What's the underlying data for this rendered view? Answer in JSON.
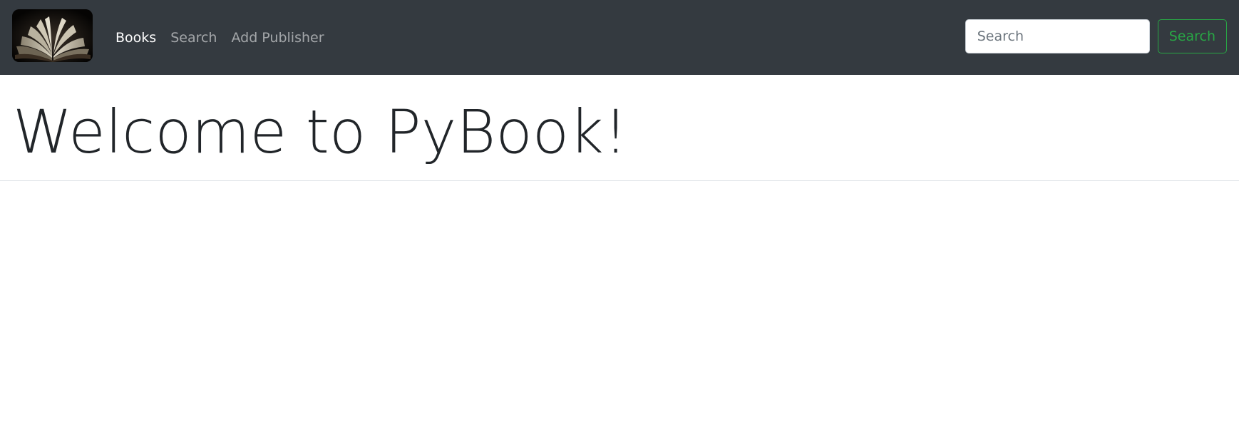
{
  "navbar": {
    "logo_name": "open-book-logo",
    "links": [
      {
        "label": "Books",
        "active": true
      },
      {
        "label": "Search",
        "active": false
      },
      {
        "label": "Add Publisher",
        "active": false
      }
    ],
    "search": {
      "placeholder": "Search",
      "value": "",
      "button_label": "Search"
    }
  },
  "main": {
    "title": "Welcome to PyBook!"
  },
  "colors": {
    "navbar_bg": "#343a40",
    "success": "#28a745",
    "text": "#212529"
  }
}
